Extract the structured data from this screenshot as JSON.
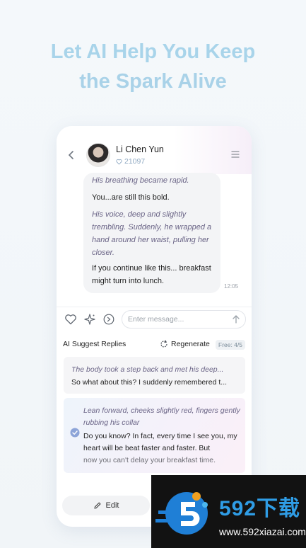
{
  "headline": {
    "line1": "Let AI Help You Keep",
    "line2": "the Spark Alive"
  },
  "chat_header": {
    "name": "Li Chen Yun",
    "likes": "21097",
    "back_icon": "chevron-left-icon",
    "menu_icon": "menu-icon"
  },
  "messages": [
    {
      "kind": "narration",
      "text": "His breathing became rapid."
    },
    {
      "kind": "speech",
      "text": "You...are still this bold."
    },
    {
      "kind": "narration",
      "text": "His voice, deep and slightly trembling. Suddenly, he wrapped a hand around her waist, pulling her closer."
    },
    {
      "kind": "speech",
      "text": "If you continue like this... breakfast might turn into lunch."
    }
  ],
  "message_time": "12:05",
  "composer": {
    "placeholder": "Enter message..."
  },
  "suggestions": {
    "title": "AI Suggest Replies",
    "regenerate": "Regenerate",
    "free": "Free: 4/5",
    "items": [
      {
        "narration": "The body took a step back and met his deep...",
        "speech": "So what about this? I suddenly remembered t..."
      },
      {
        "narration": "Lean forward, cheeks slightly red, fingers gently rubbing his collar",
        "speech": "Do you know? In fact, every time I see you, my heart will be beat faster and faster. But",
        "speech_faded": "now you can't delay your breakfast time.",
        "selected": true
      }
    ]
  },
  "edit_button": "Edit",
  "watermark": {
    "title": "592下载",
    "url": "www.592xiazai.com"
  },
  "colors": {
    "headline": "#a8d4ea",
    "narration": "#6a6486",
    "accent": "#2f9de6"
  }
}
